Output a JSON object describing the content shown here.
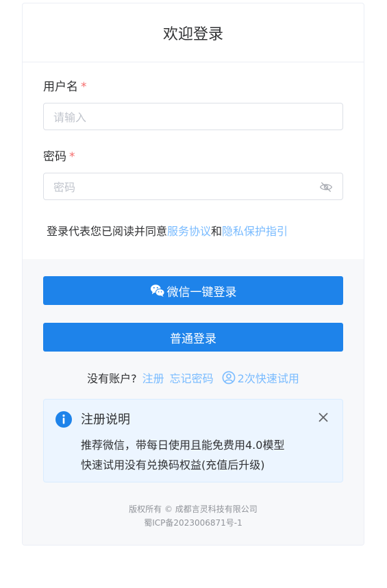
{
  "header": {
    "title": "欢迎登录"
  },
  "form": {
    "username": {
      "label": "用户名",
      "required_mark": "*",
      "placeholder": "请输入"
    },
    "password": {
      "label": "密码",
      "required_mark": "*",
      "placeholder": "密码"
    },
    "agreement": {
      "prefix": "登录代表您已阅读并同意",
      "service_link": "服务协议",
      "and": "和",
      "privacy_link": "隐私保护指引"
    }
  },
  "actions": {
    "wechat_login": "微信一键登录",
    "normal_login": "普通登录"
  },
  "links": {
    "no_account": "没有账户?",
    "register": "注册",
    "forgot": "忘记密码",
    "quick_try": "2次快速试用"
  },
  "notice": {
    "title": "注册说明",
    "line1": "推荐微信，带每日使用且能免费用4.0模型",
    "line2": "快速试用没有兑换码权益(充值后升级)"
  },
  "footer": {
    "copyright": "版权所有 © 成都言灵科技有限公司",
    "icp": "蜀ICP备2023006871号-1"
  },
  "icons": {
    "password_toggle": "eye-off-icon",
    "wechat": "wechat-icon",
    "user": "user-circle-icon",
    "info": "info-icon",
    "close": "close-icon"
  },
  "colors": {
    "primary": "#1e83ea",
    "link": "#79bbff",
    "required": "#f56c6c",
    "notice_bg": "#ecf5ff"
  }
}
